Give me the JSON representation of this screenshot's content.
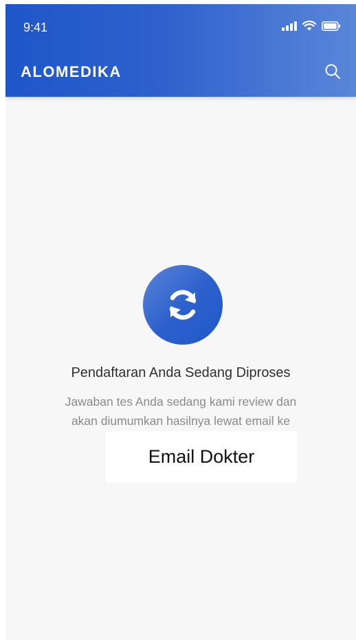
{
  "status_bar": {
    "time": "9:41",
    "icons": [
      "signal-icon",
      "wifi-icon",
      "battery-icon"
    ]
  },
  "header": {
    "brand": "ALOMEDIKA",
    "search_icon": "search-icon"
  },
  "main": {
    "status_icon": "refresh-icon",
    "title": "Pendaftaran Anda Sedang Diproses",
    "description_line1": "Jawaban tes Anda sedang kami review dan",
    "description_line2": "akan diumumkan hasilnya lewat email ke",
    "email": "Email Dokter"
  },
  "colors": {
    "primary": "#1f56c7",
    "primary_light": "#5a86d9",
    "background": "#f7f7f8",
    "title_text": "#2f2f2f",
    "muted_text": "#8a8a8a"
  }
}
